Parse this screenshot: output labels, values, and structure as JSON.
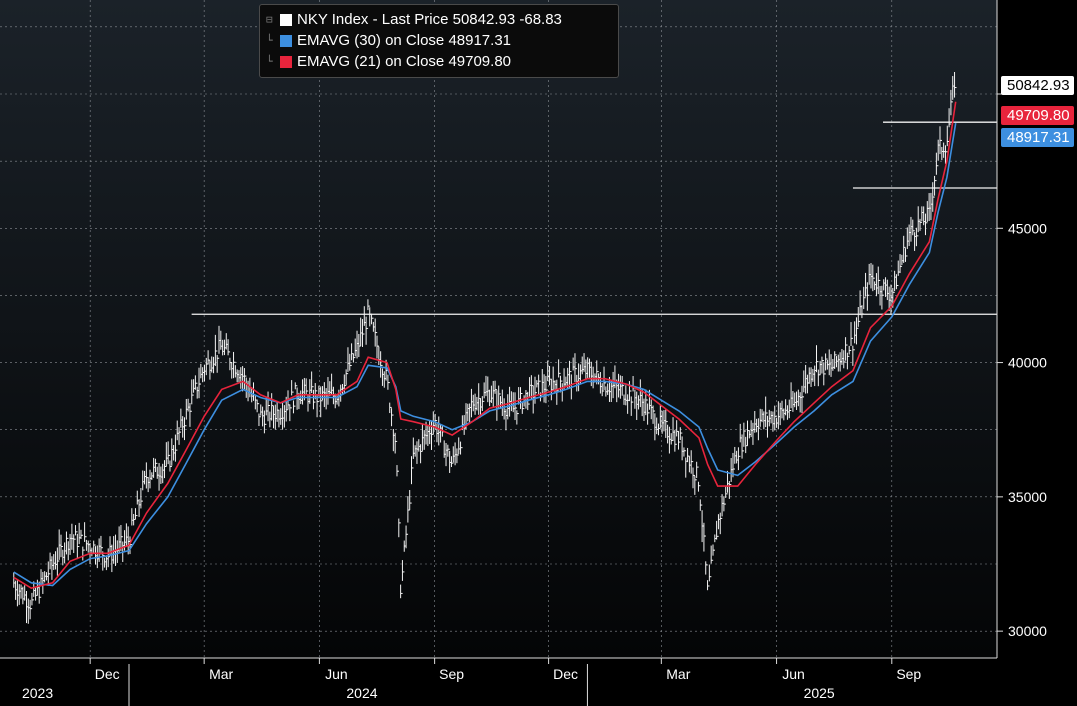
{
  "legend": {
    "row1": "NKY Index - Last Price 50842.93  -68.83",
    "row2": "EMAVG (30)  on Close  48917.31",
    "row3": "EMAVG (21)  on Close  49709.80",
    "colors": {
      "price": "#ffffff",
      "ema30": "#3d8fe0",
      "ema21": "#e8243c"
    }
  },
  "tags": {
    "last": "50842.93",
    "ema21": "49709.80",
    "ema30": "48917.31"
  },
  "chart_data": {
    "type": "line",
    "title": "NKY Index - Last Price",
    "ylim": [
      29000,
      53500
    ],
    "yticks": [
      "30000",
      "35000",
      "40000",
      "45000"
    ],
    "months": [
      "Dec",
      "Mar",
      "Jun",
      "Sep",
      "Dec",
      "Mar",
      "Jun",
      "Sep"
    ],
    "years": [
      "2023",
      "2024",
      "2025"
    ],
    "grid": true,
    "x": [
      "2023-10-01",
      "2023-10-15",
      "2023-11-01",
      "2023-11-15",
      "2023-12-01",
      "2023-12-15",
      "2024-01-01",
      "2024-01-15",
      "2024-02-01",
      "2024-02-15",
      "2024-03-01",
      "2024-03-15",
      "2024-04-01",
      "2024-04-15",
      "2024-05-01",
      "2024-05-15",
      "2024-06-01",
      "2024-06-15",
      "2024-07-01",
      "2024-07-10",
      "2024-07-25",
      "2024-08-01",
      "2024-08-05",
      "2024-08-15",
      "2024-09-01",
      "2024-09-15",
      "2024-10-01",
      "2024-10-15",
      "2024-11-01",
      "2024-11-15",
      "2024-12-01",
      "2024-12-15",
      "2025-01-01",
      "2025-01-15",
      "2025-02-01",
      "2025-02-15",
      "2025-03-01",
      "2025-03-15",
      "2025-03-31",
      "2025-04-07",
      "2025-04-15",
      "2025-05-01",
      "2025-05-15",
      "2025-06-01",
      "2025-06-15",
      "2025-07-01",
      "2025-07-15",
      "2025-08-01",
      "2025-08-15",
      "2025-09-01",
      "2025-09-15",
      "2025-10-01",
      "2025-10-08",
      "2025-10-15",
      "2025-10-22"
    ],
    "series": [
      {
        "name": "NKY Index - Last Price",
        "values": [
          31800,
          31000,
          32500,
          33500,
          33200,
          32800,
          33400,
          35800,
          36200,
          38000,
          39800,
          40600,
          39500,
          38000,
          38200,
          38900,
          38700,
          38800,
          40500,
          41800,
          39300,
          37000,
          31500,
          36500,
          37800,
          36200,
          38500,
          38900,
          38200,
          38800,
          39200,
          39400,
          39700,
          39200,
          38900,
          38500,
          37600,
          37200,
          35600,
          31400,
          34000,
          36800,
          37800,
          38000,
          38400,
          39900,
          39800,
          40800,
          43200,
          42500,
          44800,
          45500,
          47900,
          48200,
          50842.93
        ]
      },
      {
        "name": "EMAVG (30)",
        "values": [
          32200,
          31800,
          31700,
          32300,
          32700,
          32800,
          33000,
          34000,
          35000,
          36200,
          37500,
          38600,
          39000,
          38700,
          38500,
          38700,
          38700,
          38700,
          39100,
          39900,
          39800,
          39100,
          38200,
          38000,
          37800,
          37500,
          37800,
          38200,
          38400,
          38600,
          38800,
          39000,
          39300,
          39300,
          39200,
          39000,
          38600,
          38200,
          37600,
          36800,
          36000,
          35800,
          36300,
          37000,
          37600,
          38200,
          38800,
          39300,
          40800,
          41700,
          42900,
          44100,
          45600,
          46900,
          48917.31
        ]
      },
      {
        "name": "EMAVG (21)",
        "values": [
          32000,
          31600,
          31800,
          32600,
          32900,
          32900,
          33200,
          34400,
          35500,
          36700,
          38000,
          39000,
          39300,
          38800,
          38500,
          38800,
          38800,
          38800,
          39300,
          40200,
          40000,
          39000,
          37900,
          37800,
          37600,
          37300,
          37800,
          38300,
          38500,
          38700,
          38900,
          39100,
          39400,
          39400,
          39200,
          38900,
          38400,
          37900,
          37200,
          36200,
          35400,
          35400,
          36200,
          37100,
          37800,
          38500,
          39100,
          39700,
          41300,
          42100,
          43300,
          44500,
          46100,
          47500,
          49709.8
        ]
      }
    ],
    "hlines": [
      41800,
      46500,
      48950
    ]
  }
}
